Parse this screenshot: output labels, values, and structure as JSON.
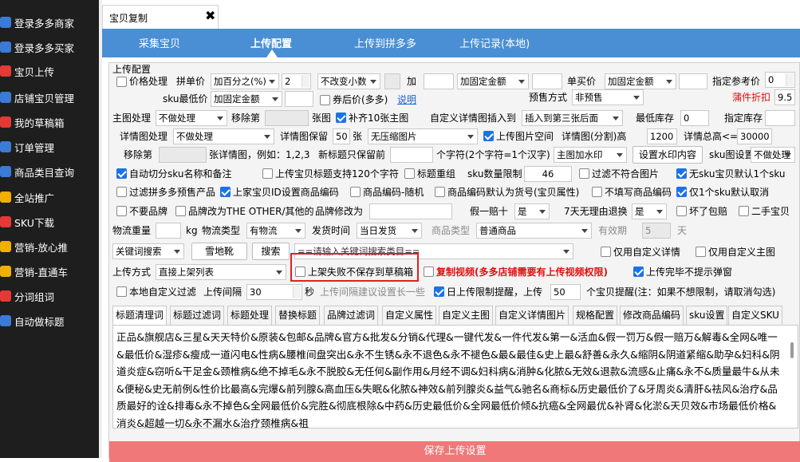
{
  "sidebar": {
    "items": [
      {
        "label": "登录多多商家",
        "icon": "monitor-icon",
        "color": "#3a7bd5"
      },
      {
        "label": "登录多多买家",
        "icon": "monitor-icon",
        "color": "#3a7bd5"
      },
      {
        "label": "宝贝上传",
        "icon": "upload-icon",
        "color": "#e53935"
      },
      {
        "label": "店铺宝贝管理",
        "icon": "edit-icon",
        "color": "#3a7bd5"
      },
      {
        "label": "我的草稿箱",
        "icon": "chart-icon",
        "color": "#e53935"
      },
      {
        "label": "订单管理",
        "icon": "list-icon",
        "color": "#3a7bd5"
      },
      {
        "label": "商品类目查询",
        "icon": "grid-icon",
        "color": "#3a7bd5"
      },
      {
        "label": "全站推广",
        "icon": "megaphone-icon",
        "color": "#f0b000"
      },
      {
        "label": "SKU下载",
        "icon": "download-icon",
        "color": "#e53935"
      },
      {
        "label": "营销-放心推",
        "icon": "megaphone-icon",
        "color": "#f0b000"
      },
      {
        "label": "营销-直通车",
        "icon": "megaphone-icon",
        "color": "#f0b000"
      },
      {
        "label": "分词组词",
        "icon": "split-icon",
        "color": "#e53935"
      },
      {
        "label": "自动做标题",
        "icon": "wand-icon",
        "color": "#3a7bd5"
      }
    ]
  },
  "doc_tab": {
    "title": "宝贝复制",
    "close": "✖"
  },
  "nav": {
    "items": [
      "采集宝贝",
      "上传配置",
      "上传到拼多多",
      "上传记录(本地)"
    ],
    "active": "上传配置"
  },
  "form": {
    "section_title": "上传配置",
    "r1": {
      "price_proc": "价格处理",
      "pin_price": "拼单价",
      "pin_method": "加百分之(%)",
      "pin_value": "2",
      "rounding": "不改变小数",
      "add": "加",
      "add_method": "加固定金额",
      "single_price": "单买价",
      "single_method": "加固定金额",
      "ref_price": "指定参考价",
      "ref_value": "0"
    },
    "r2": {
      "sku_min": "sku最低价",
      "sku_method": "加固定金额",
      "after_coupon": "券后价(多多)",
      "explain": "说明",
      "presale": "预售方式",
      "presale_value": "非预售",
      "plugin_discount": "蒲件折扣",
      "discount_value": "9.5"
    },
    "r3": {
      "main_proc": "主图处理",
      "main_method": "不做处理",
      "remove_first": "移除第",
      "main_img": "张图",
      "fill10": "补齐10张主图",
      "custom_detail_insert": "自定义详情图插入到",
      "insert_pos": "插入到第三张后面",
      "min_stock": "最低库存",
      "min_stock_value": "0",
      "fixed_stock": "指定库存"
    },
    "r4": {
      "detail_proc": "详情图处理",
      "detail_method": "不做处理",
      "detail_keep": "详情图保留",
      "keep_value": "50",
      "zhang": "张",
      "compress": "无压缩图片",
      "upload_space": "上传图片空间",
      "split_height": "详情图(分割)高",
      "split_value": "1200",
      "total_height": "详情总高<=",
      "total_value": "30000"
    },
    "r5": {
      "remove_first": "移除第",
      "detail_example": "张详情图，例如：1,2,3",
      "new_title_keep": "新标题只保留前",
      "char_note": "个字符(2个字符=1个汉字)",
      "watermark": "主图加水印",
      "set_watermark": "设置水印内容",
      "sku_img": "sku图设置",
      "sku_img_value": "不做处理"
    },
    "r6": {
      "auto_cut": "自动切分sku名称和备注",
      "title_120": "上传宝贝标题支持120个字符",
      "title_regroup": "标题重组",
      "sku_limit": "sku数量限制",
      "sku_limit_value": "46",
      "filter_img": "过滤不符合图片",
      "no_sku_default": "无sku宝贝默认1个sku"
    },
    "r7": {
      "filter_presale": "过滤拼多多预售产品",
      "set_code": "上家宝贝ID设置商品编码",
      "random_code": "商品编码-随机",
      "code_as_sku": "商品编码默认为货号(宝贝属性)",
      "no_code": "不填写商品编码",
      "one_sku_default": "仅1个sku默认取消"
    },
    "r8": {
      "no_brand": "不要品牌",
      "brand_other": "品牌改为THE OTHER/其他的",
      "brand_edit": "品牌修改为",
      "fake_penalty": "假一赔十",
      "fake_value": "是",
      "seven_day": "7天无理由退换",
      "seven_value": "是",
      "bad_refund": "坏了包赔",
      "second_hand": "二手宝贝"
    },
    "r9": {
      "logistics_weight": "物流重量",
      "kg": "kg",
      "logistics_type": "物流类型",
      "logistics_value": "有物流",
      "ship_time": "发货时间",
      "ship_value": "当日发货",
      "goods_type": "商品类型",
      "goods_value": "普通商品",
      "validity": "有效期",
      "validity_value": "5",
      "day": "天"
    },
    "r10": {
      "keyword_filter": "关键词搜索",
      "local_shoes": "雪地靴",
      "search": "搜索",
      "kw_placeholder": "==请输入关键词搜索类目==",
      "only_custom_detail": "仅用自定义详情",
      "only_custom_main": "仅用自定义主图"
    },
    "r11": {
      "upload_method": "上传方式",
      "upload_value": "直接上架列表",
      "no_draft": "上架失败不保存到草稿箱",
      "copy_video": "复制视频(多多店铺需要有上传视频权限)",
      "no_popup": "上传完毕不提示弹窗"
    },
    "r12": {
      "local_filter": "本地自定义过滤",
      "upload_interval": "上传间隔",
      "interval_value": "30",
      "seconds": "秒",
      "interval_hint": "上传间隔建议设置长一些",
      "daily_limit": "日上传限制提醒，上传",
      "daily_value": "50",
      "daily_note": "个宝贝提醒(注：如果不想限制，请取消勾选)"
    }
  },
  "subtabs": [
    "标题清理词",
    "标题过滤词",
    "标题处理",
    "替换标题",
    "品牌过滤词",
    "自定义属性",
    "自定义主图",
    "自定义详情图片",
    "规格配置",
    "修改商品编码",
    "sku设置",
    "自定义SKU"
  ],
  "active_subtab": "标题清理词",
  "cleanup_words": "正品&旗舰店&三星&天天特价&原装&包邮&品牌&官方&批发&分销&代理&一键代发&一件代发&第一&活血&假一罚万&假一赔万&解毒&全网&唯一&最低价&湿疹&瘦成一道闪电&性病&腰椎间盘突出&永不生锈&永不退色&永不褪色&最&最佳&史上最&舒善&永久&缩阴&阴道紧缩&助孕&妇科&阴道炎症&窃听&干足金&颈椎病&绝不掉毛&永不脱胶&无任何&副作用&月经不调&妇科病&消肿&化脓&无效&退款&流感&止痛&永不&质量最牛&从未&便秘&史无前例&性价比最高&完爆&前列腺&高血压&失眠&化脓&神效&前列腺炎&益气&驰名&商标&历史最低价了&牙周炎&清肝&祛风&治疗&品质最好的诠&排毒&永不掉色&全网最低价&完胜&彻底根除&中药&历史最低价&全网最低价倾&抗癌&全网最优&补肾&化淤&天贝效&市场最低价格&消炎&超越一切&永不漏水&治疗颈椎病&祖",
  "save_button": "保存上传设置"
}
